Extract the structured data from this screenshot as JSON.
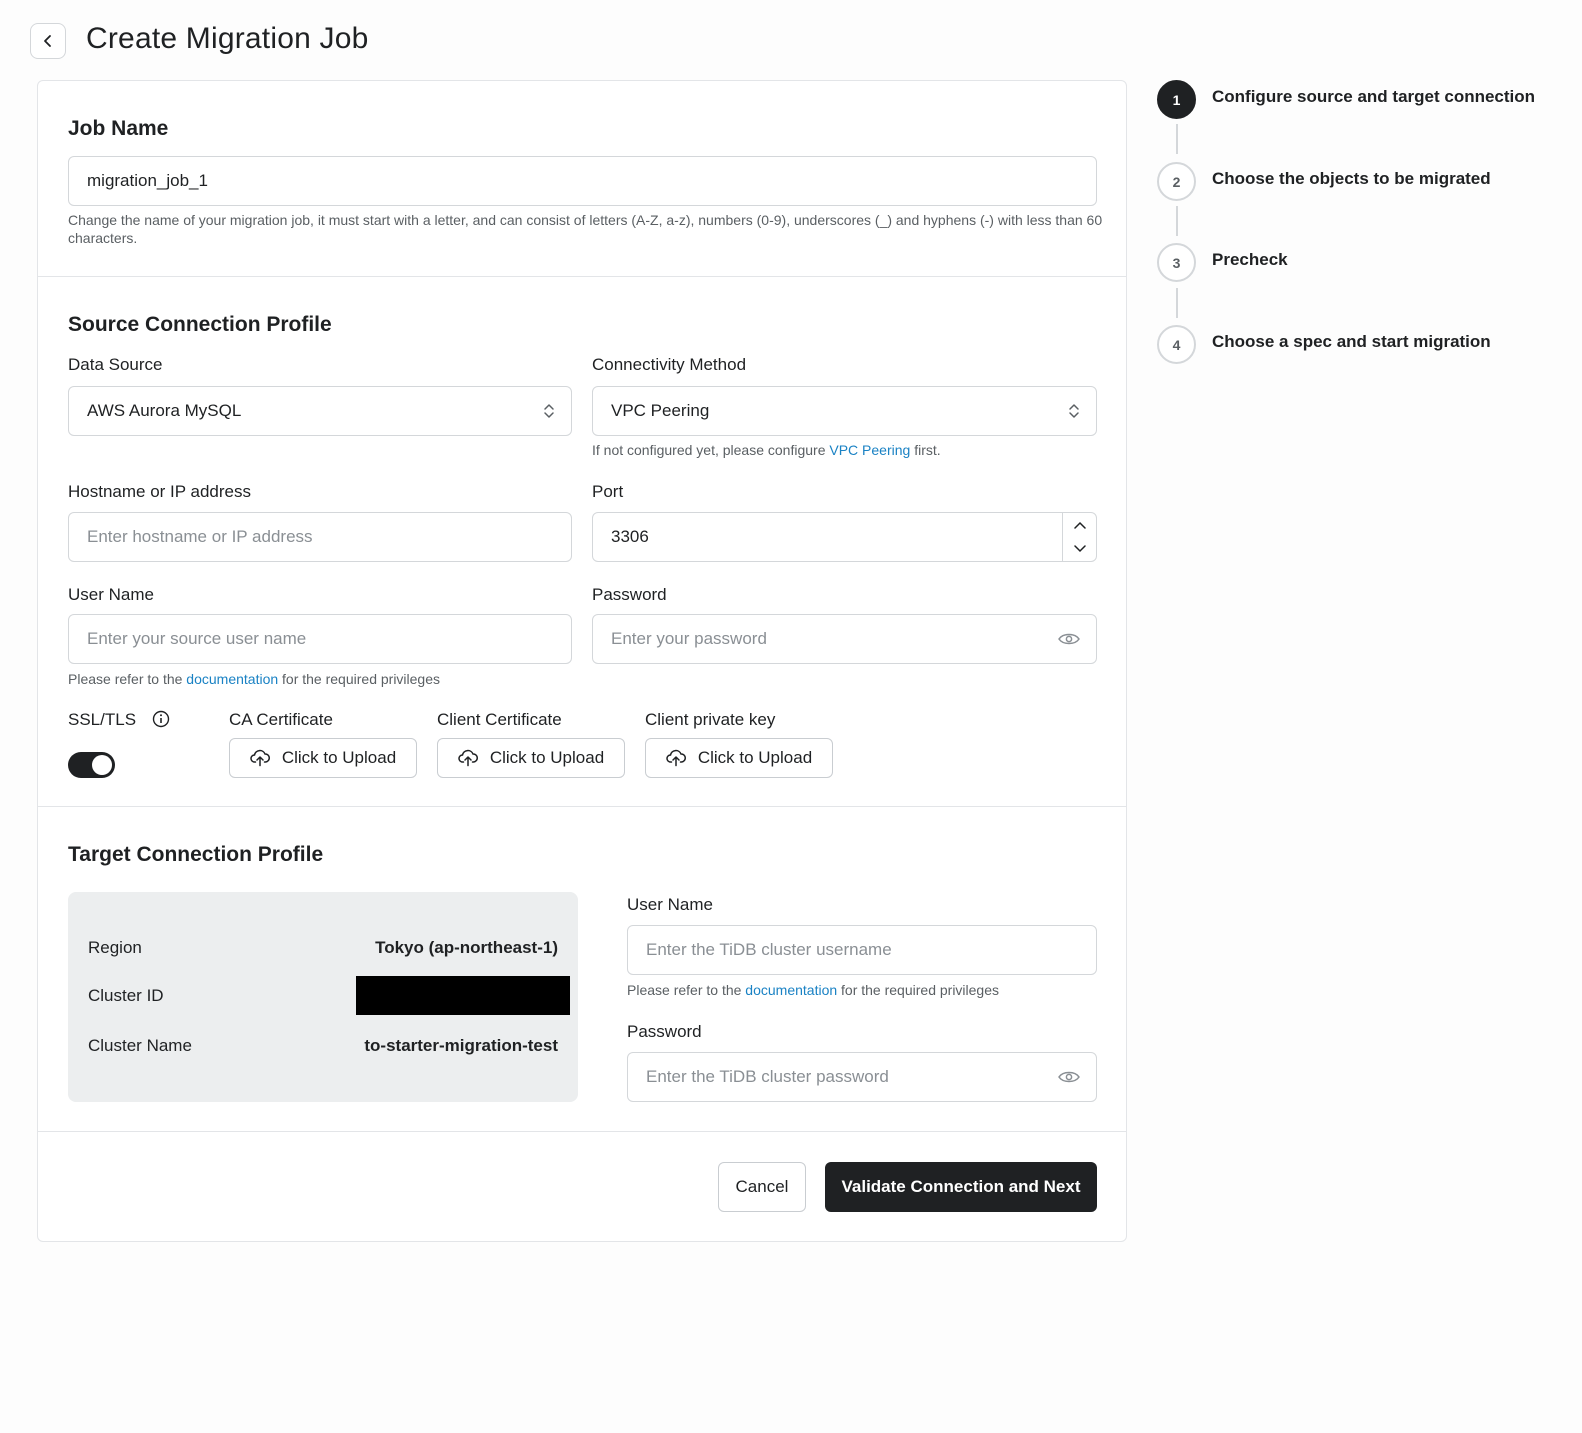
{
  "header": {
    "title": "Create Migration Job"
  },
  "job_name": {
    "section_title": "Job Name",
    "value": "migration_job_1",
    "help": "Change the name of your migration job, it must start with a letter, and can consist of letters (A-Z, a-z), numbers (0-9), underscores (_) and hyphens (-) with less than 60 characters."
  },
  "source": {
    "section_title": "Source Connection Profile",
    "data_source_label": "Data Source",
    "data_source_value": "AWS Aurora MySQL",
    "connectivity_label": "Connectivity Method",
    "connectivity_value": "VPC Peering",
    "connectivity_help_prefix": "If not configured yet, please configure ",
    "connectivity_help_link": "VPC Peering",
    "connectivity_help_suffix": " first.",
    "hostname_label": "Hostname or IP address",
    "hostname_placeholder": "Enter hostname or IP address",
    "port_label": "Port",
    "port_value": "3306",
    "username_label": "User Name",
    "username_placeholder": "Enter your source user name",
    "password_label": "Password",
    "password_placeholder": "Enter your password",
    "privileges_help_prefix": "Please refer to the ",
    "privileges_help_link": "documentation",
    "privileges_help_suffix": " for the required privileges",
    "ssl_label": "SSL/TLS",
    "ssl_enabled": true,
    "ca_cert_label": "CA Certificate",
    "client_cert_label": "Client Certificate",
    "client_key_label": "Client private key",
    "upload_label": "Click to Upload"
  },
  "target": {
    "section_title": "Target Connection Profile",
    "region_label": "Region",
    "region_value": "Tokyo (ap-northeast-1)",
    "cluster_id_label": "Cluster ID",
    "cluster_name_label": "Cluster Name",
    "cluster_name_value": "to-starter-migration-test",
    "username_label": "User Name",
    "username_placeholder": "Enter the TiDB cluster username",
    "privileges_help_prefix": "Please refer to the ",
    "privileges_help_link": "documentation",
    "privileges_help_suffix": " for the required privileges",
    "password_label": "Password",
    "password_placeholder": "Enter the TiDB cluster password"
  },
  "actions": {
    "cancel_label": "Cancel",
    "primary_label": "Validate Connection and Next"
  },
  "steps": [
    {
      "number": "1",
      "label": "Configure source and target connection",
      "active": true
    },
    {
      "number": "2",
      "label": "Choose the objects to be migrated",
      "active": false
    },
    {
      "number": "3",
      "label": "Precheck",
      "active": false
    },
    {
      "number": "4",
      "label": "Choose a spec and start migration",
      "active": false
    }
  ],
  "colors": {
    "text": "#1f2123",
    "link": "#1a82c4",
    "border": "#d4d7da",
    "primary_button": "#1f2123",
    "info_box": "#eceeef"
  }
}
